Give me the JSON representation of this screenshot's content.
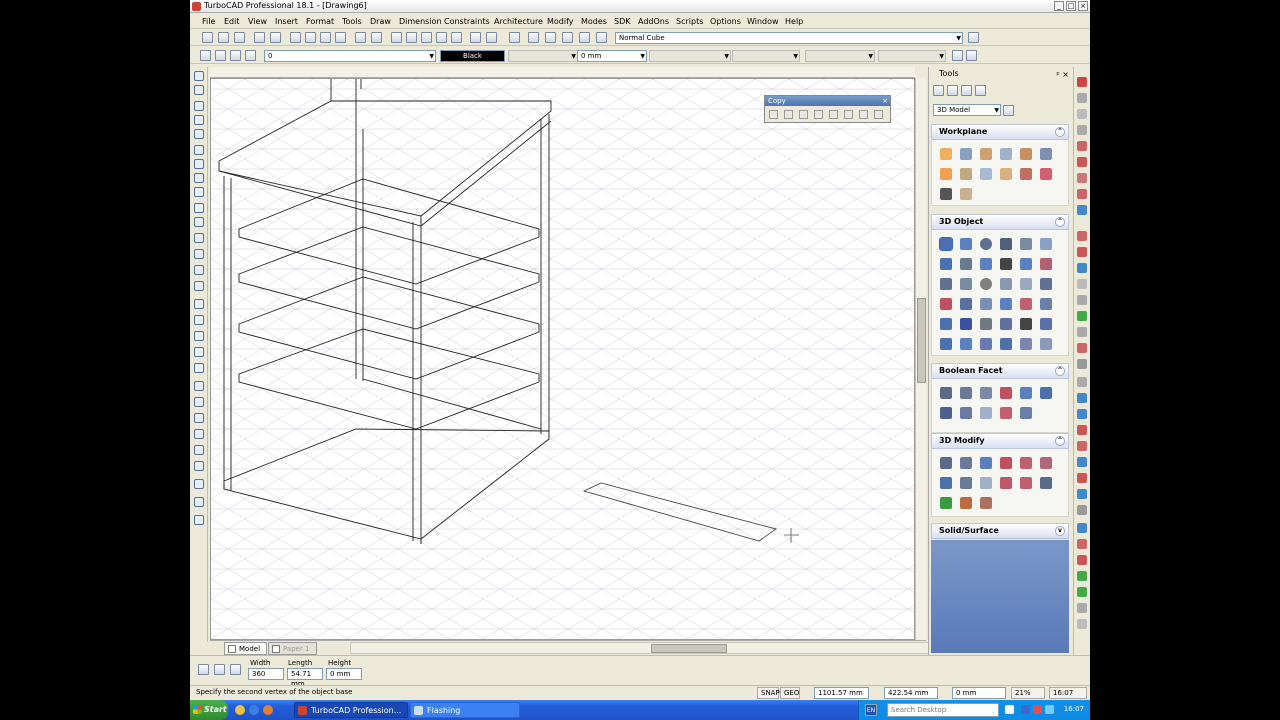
{
  "window": {
    "title": "TurboCAD Professional 18.1 - [Drawing6]",
    "buttons": [
      "_",
      "□",
      "×"
    ]
  },
  "menu": [
    "File",
    "Edit",
    "View",
    "Insert",
    "Format",
    "Tools",
    "Draw",
    "Dimension",
    "Constraints",
    "Architecture",
    "Modify",
    "Modes",
    "SDK",
    "AddOns",
    "Scripts",
    "Options",
    "Window",
    "Help"
  ],
  "toolbar": {
    "style_combo": "Normal Cube",
    "layer_value": "0",
    "color_value": "Black",
    "width_value": "0 mm"
  },
  "copy_toolbar": {
    "title": "Copy",
    "close": "×"
  },
  "tabs": {
    "model": "Model",
    "paper": "Paper 1"
  },
  "inspector": {
    "width_label": "Width",
    "length_label": "Length",
    "height_label": "Height",
    "width_value": "360",
    "length_value": "54.71 mm",
    "height_value": "0 mm"
  },
  "status": {
    "prompt": "Specify the second vertex of the object base",
    "snap": "SNAP",
    "geo": "GEO",
    "x_coord": "1101.57 mm",
    "y_coord": "422.54 mm",
    "z_coord": "0 mm",
    "zoom": "21%",
    "time": "16:07"
  },
  "palette": {
    "title": "Tools",
    "header_buttons": "ᵖ ×",
    "combo": "3D Model",
    "sections": {
      "workplane": "Workplane",
      "object3d": "3D Object",
      "boolean": "Boolean Facet",
      "modify3d": "3D Modify",
      "solid": "Solid/Surface"
    }
  },
  "taskbar": {
    "start": "Start",
    "task1": "TurboCAD Profession...",
    "task2": "Flashing",
    "search_placeholder": "Search Desktop",
    "lang": "EN",
    "clock": "16:07"
  },
  "colors": {
    "xp_blue": "#245edb",
    "palette_head": "#d7def0",
    "canvas_grid": "#c9ced8"
  }
}
